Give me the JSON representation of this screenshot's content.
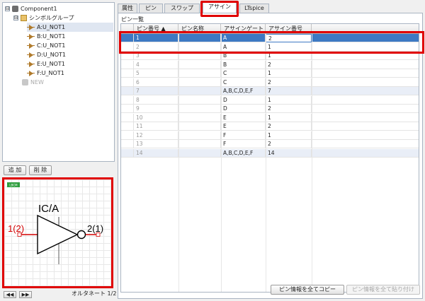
{
  "tree": {
    "root": "Component1",
    "group": "シンボルグループ",
    "items": [
      "A:U_NOT1",
      "B:U_NOT1",
      "C:U_NOT1",
      "D:U_NOT1",
      "E:U_NOT1",
      "F:U_NOT1"
    ],
    "new_label": "NEW",
    "expand_glyph": "⊟"
  },
  "buttons": {
    "add": "追 加",
    "delete": "削 除",
    "copy_all": "ピン情報を全てコピー",
    "paste_all": "ピン情報を全て貼り付け"
  },
  "preview": {
    "badge": "LBCM",
    "symbol_name": "IC/A",
    "pin_in": "1(2)",
    "pin_out": "2(1)"
  },
  "alt_nav": {
    "prev": "◀◀",
    "next": "▶▶",
    "label": "オルタネート 1/2"
  },
  "tabs": [
    "属性",
    "ピン",
    "スワップ",
    "アサイン",
    "LTspice"
  ],
  "active_tab": "アサイン",
  "section_title": "ピン一覧",
  "table": {
    "columns": [
      "ピン番号 ▲",
      "ピン名称",
      "アサインゲート",
      "アサイン番号"
    ],
    "rows": [
      {
        "pin": "1",
        "name": "",
        "gate": "A",
        "assign": "2"
      },
      {
        "pin": "2",
        "name": "",
        "gate": "A",
        "assign": "1"
      },
      {
        "pin": "3",
        "name": "",
        "gate": "B",
        "assign": "1"
      },
      {
        "pin": "4",
        "name": "",
        "gate": "B",
        "assign": "2"
      },
      {
        "pin": "5",
        "name": "",
        "gate": "C",
        "assign": "1"
      },
      {
        "pin": "6",
        "name": "",
        "gate": "C",
        "assign": "2"
      },
      {
        "pin": "7",
        "name": "",
        "gate": "A,B,C,D,E,F",
        "assign": "7"
      },
      {
        "pin": "8",
        "name": "",
        "gate": "D",
        "assign": "1"
      },
      {
        "pin": "9",
        "name": "",
        "gate": "D",
        "assign": "2"
      },
      {
        "pin": "10",
        "name": "",
        "gate": "E",
        "assign": "1"
      },
      {
        "pin": "11",
        "name": "",
        "gate": "E",
        "assign": "2"
      },
      {
        "pin": "12",
        "name": "",
        "gate": "F",
        "assign": "1"
      },
      {
        "pin": "13",
        "name": "",
        "gate": "F",
        "assign": "2"
      },
      {
        "pin": "14",
        "name": "",
        "gate": "A,B,C,D,E,F",
        "assign": "14"
      }
    ]
  },
  "colors": {
    "highlight_red": "#e00000",
    "selection_blue": "#3d79c3",
    "alt_row": "#e9eef7"
  }
}
